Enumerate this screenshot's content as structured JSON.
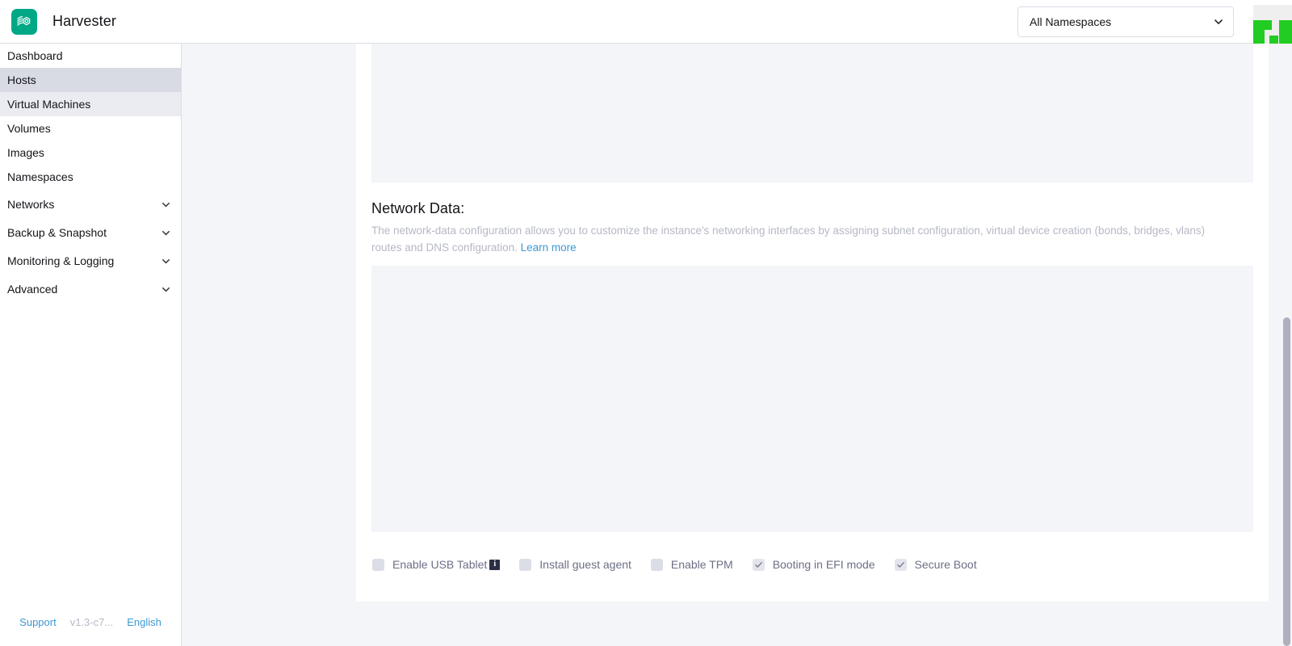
{
  "header": {
    "brand_name": "Harvester",
    "logo_icon": "harvester-logo-icon",
    "namespace_selected": "All Namespaces",
    "namespace_chevron_icon": "chevron-down-icon",
    "corner_mark_icon": "green-pixel-mark-icon",
    "accent_color": "#00a886"
  },
  "sidebar": {
    "items": [
      {
        "label": "Dashboard",
        "state": "default",
        "expandable": false
      },
      {
        "label": "Hosts",
        "state": "active-strong",
        "expandable": false
      },
      {
        "label": "Virtual Machines",
        "state": "active-soft",
        "expandable": false
      },
      {
        "label": "Volumes",
        "state": "default",
        "expandable": false
      },
      {
        "label": "Images",
        "state": "default",
        "expandable": false
      },
      {
        "label": "Namespaces",
        "state": "default",
        "expandable": false
      },
      {
        "label": "Networks",
        "state": "default",
        "expandable": true
      },
      {
        "label": "Backup & Snapshot",
        "state": "default",
        "expandable": true
      },
      {
        "label": "Monitoring & Logging",
        "state": "default",
        "expandable": true
      },
      {
        "label": "Advanced",
        "state": "default",
        "expandable": true
      }
    ],
    "footer": {
      "support_label": "Support",
      "version_label": "v1.3-c7...",
      "language_label": "English"
    }
  },
  "main": {
    "user_data_box_placeholder": "",
    "network_data": {
      "heading": "Network Data:",
      "description_part1": "The network-data configuration allows you to customize the instance's networking interfaces by assigning subnet configuration, virtual device creation (bonds, bridges, vlans) routes and DNS configuration.",
      "learn_more_label": "Learn more",
      "editor_placeholder": ""
    },
    "options": [
      {
        "label": "Enable USB Tablet",
        "checked": false,
        "has_info": true
      },
      {
        "label": "Install guest agent",
        "checked": false,
        "has_info": false
      },
      {
        "label": "Enable TPM",
        "checked": false,
        "has_info": false
      },
      {
        "label": "Booting in EFI mode",
        "checked": true,
        "has_info": false
      },
      {
        "label": "Secure Boot",
        "checked": true,
        "has_info": false
      }
    ],
    "info_badge_glyph": "i"
  },
  "scrollbar": {
    "thumb_name": "vertical-scrollbar-thumb"
  }
}
